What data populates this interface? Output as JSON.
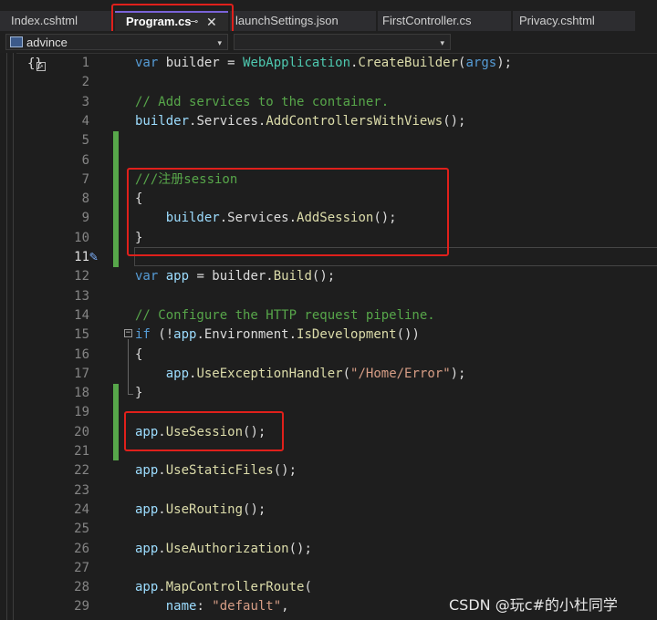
{
  "tabs": [
    {
      "label": "Index.cshtml"
    },
    {
      "label": "Program.cs",
      "pin": "⊸",
      "close": "✕"
    },
    {
      "label": "launchSettings.json"
    },
    {
      "label": "FirstController.cs"
    },
    {
      "label": "Privacy.cshtml"
    }
  ],
  "nav": {
    "project": "advince",
    "arrow": "▾"
  },
  "glyph": "{}",
  "line_numbers": [
    "1",
    "2",
    "3",
    "4",
    "5",
    "6",
    "7",
    "8",
    "9",
    "10",
    "11",
    "12",
    "13",
    "14",
    "15",
    "16",
    "17",
    "18",
    "19",
    "20",
    "21",
    "22",
    "23",
    "24",
    "25",
    "26",
    "27",
    "28",
    "29"
  ],
  "code": {
    "l1": {
      "a": "var",
      "b": " builder ",
      "c": "=",
      "d": " WebApplication",
      "e": ".",
      "f": "CreateBuilder",
      "g": "(",
      "h": "args",
      "i": ");"
    },
    "l3": "// Add services to the container.",
    "l4": {
      "a": "builder",
      "b": ".Services.",
      "c": "AddControllersWithViews",
      "d": "();"
    },
    "l7": "///注册session",
    "l8": "{",
    "l9": {
      "a": "    builder",
      "b": ".Services.",
      "c": "AddSession",
      "d": "();"
    },
    "l10": "}",
    "l12": {
      "a": "var",
      "b": " app ",
      "c": "= builder.",
      "d": "Build",
      "e": "();"
    },
    "l14": "// Configure the HTTP request pipeline.",
    "l15": {
      "a": "if",
      "b": " (!",
      "c": "app",
      "d": ".Environment.",
      "e": "IsDevelopment",
      "f": "())"
    },
    "l16": "{",
    "l17": {
      "a": "    app",
      "b": ".",
      "c": "UseExceptionHandler",
      "d": "(",
      "e": "\"/Home/Error\"",
      "f": ");"
    },
    "l18": "}",
    "l20": {
      "a": "app",
      "b": ".",
      "c": "UseSession",
      "d": "();"
    },
    "l22": {
      "a": "app",
      "b": ".",
      "c": "UseStaticFiles",
      "d": "();"
    },
    "l24": {
      "a": "app",
      "b": ".",
      "c": "UseRouting",
      "d": "();"
    },
    "l26": {
      "a": "app",
      "b": ".",
      "c": "UseAuthorization",
      "d": "();"
    },
    "l28": {
      "a": "app",
      "b": ".",
      "c": "MapControllerRoute",
      "d": "("
    },
    "l29": {
      "a": "    name",
      "b": ": ",
      "c": "\"default\"",
      "d": ","
    }
  },
  "watermark": "CSDN @玩c#的小杜同学",
  "colors": {
    "keyword": "#569cd6",
    "class": "#4ec9b0",
    "method": "#dcdcaa",
    "comment": "#57a64a",
    "string": "#d69d85",
    "highlight": "#e0201b"
  }
}
